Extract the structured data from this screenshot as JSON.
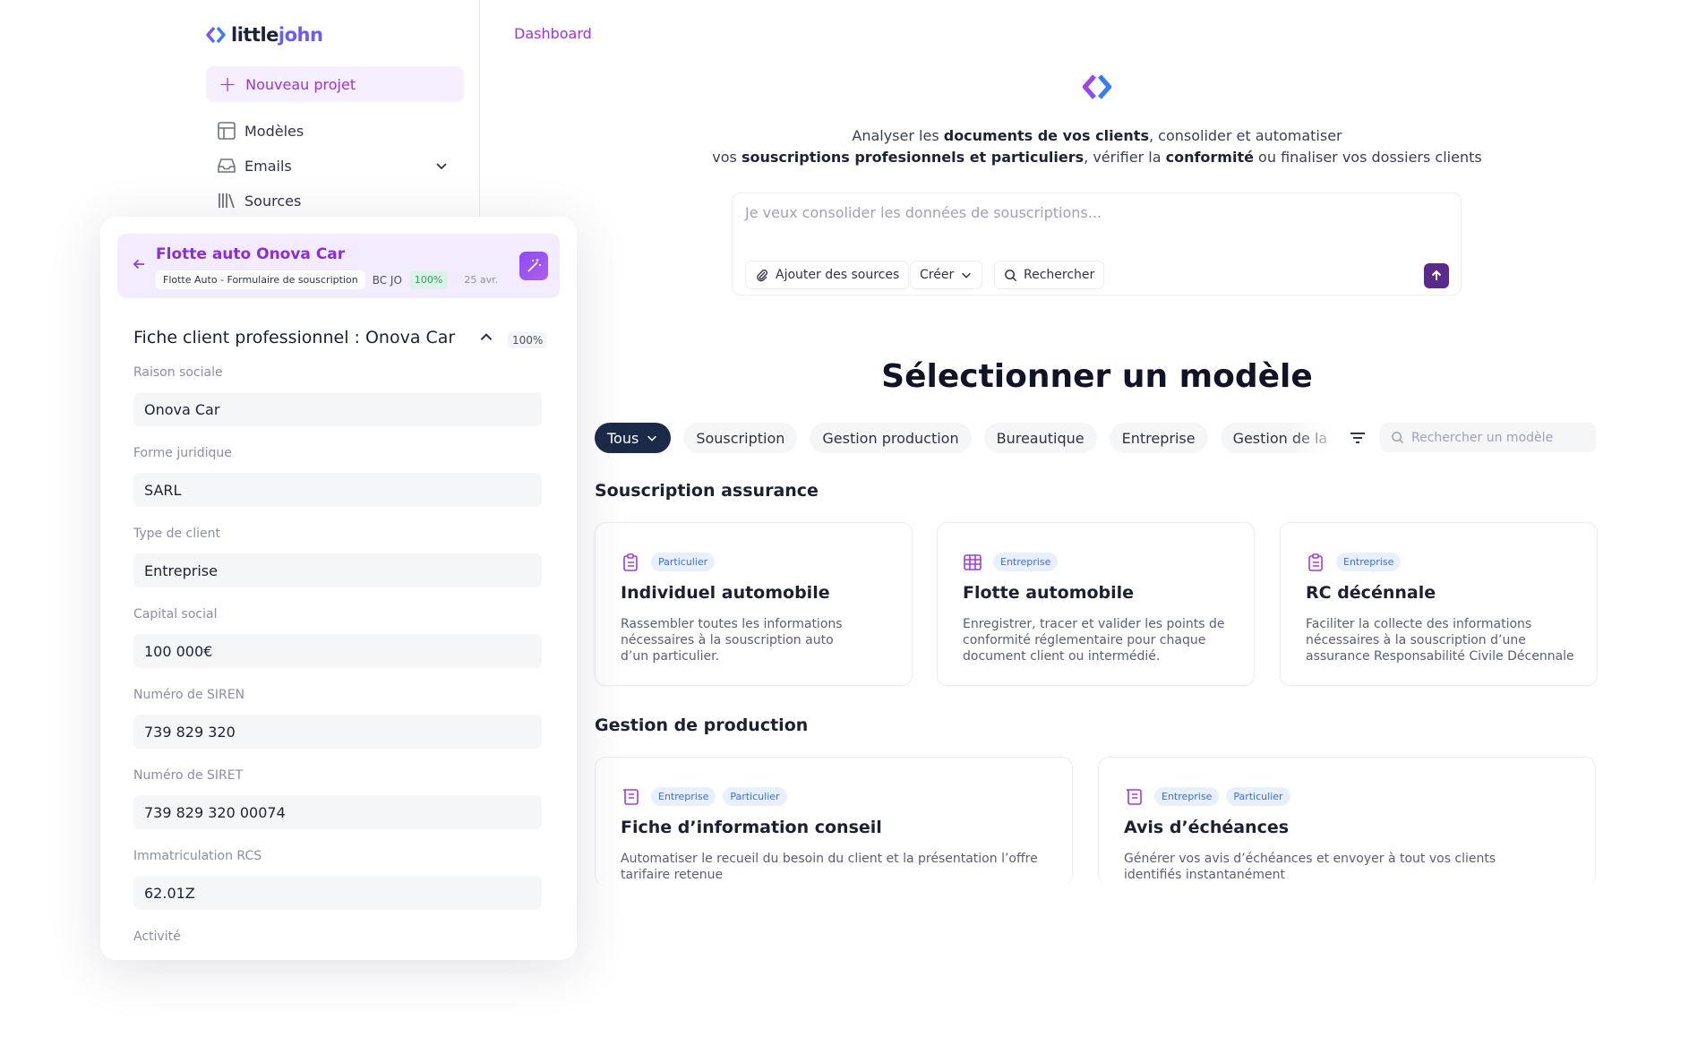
{
  "app": {
    "logo_prefix": "little",
    "logo_suffix": "john"
  },
  "sidebar": {
    "new_project": "Nouveau projet",
    "items": [
      {
        "label": "Modèles",
        "icon": "layout-icon"
      },
      {
        "label": "Emails",
        "icon": "inbox-icon"
      },
      {
        "label": "Sources",
        "icon": "library-icon"
      }
    ]
  },
  "record": {
    "title": "Flotte auto Onova Car",
    "form_chip": "Flotte Auto - Formulaire de souscription",
    "initials": "BC JO",
    "progress": "100%",
    "date": "25 avr."
  },
  "fiche": {
    "title": "Fiche client professionnel : Onova Car",
    "progress": "100%",
    "fields": [
      {
        "label": "Raison sociale",
        "value": "Onova Car"
      },
      {
        "label": "Forme juridique",
        "value": "SARL"
      },
      {
        "label": "Type de client",
        "value": "Entreprise"
      },
      {
        "label": "Capital social",
        "value": "100 000€"
      },
      {
        "label": "Numéro de SIREN",
        "value": "739 829 320"
      },
      {
        "label": "Numéro de SIRET",
        "value": "739 829 320 00074"
      },
      {
        "label": "Immatriculation RCS",
        "value": "62.01Z"
      },
      {
        "label": "Activité",
        "value": ""
      }
    ]
  },
  "main": {
    "breadcrumb": "Dashboard",
    "hero": {
      "l1_a": "Analyser les ",
      "l1_b": "documents de vos clients",
      "l1_c": ", consolider et automatiser",
      "l2_a": "vos ",
      "l2_b": "souscriptions profesionnels et particuliers",
      "l2_c": ", vérifier la ",
      "l2_d": "conformité",
      "l2_e": " ou finaliser vos dossiers clients"
    },
    "prompt": {
      "placeholder": "Je veux consolider les données de souscriptions...",
      "add_sources": "Ajouter des sources",
      "create": "Créer",
      "search": "Rechercher"
    },
    "section_title": "Sélectionner un modèle",
    "filters": [
      "Tous",
      "Souscription",
      "Gestion production",
      "Bureautique",
      "Entreprise",
      "Gestion de la"
    ],
    "search_placeholder": "Rechercher un modèle",
    "groups": [
      {
        "title": "Souscription assurance",
        "cards": [
          {
            "icon": "clipboard-icon",
            "badges": [
              "Particulier"
            ],
            "title": "Individuel automobile",
            "desc": "Rassembler toutes les informations nécessaires à la souscription auto d’un particulier."
          },
          {
            "icon": "table-icon",
            "badges": [
              "Entreprise"
            ],
            "title": "Flotte automobile",
            "desc": "Enregistrer, tracer et valider les points de conformité réglementaire pour chaque document client ou intermédié."
          },
          {
            "icon": "clipboard-icon",
            "badges": [
              "Entreprise"
            ],
            "title": "RC décénnale",
            "desc": "Faciliter la collecte des informations nécessaires à la souscription d’une assurance Responsabilité Civile Décennale"
          }
        ]
      },
      {
        "title": "Gestion de production",
        "cards": [
          {
            "icon": "scroll-icon",
            "badges": [
              "Entreprise",
              "Particulier"
            ],
            "title": "Fiche d’information conseil",
            "desc": "Automatiser le recueil du besoin du client et la présentation l’offre tarifaire retenue"
          },
          {
            "icon": "scroll-icon",
            "badges": [
              "Entreprise",
              "Particulier"
            ],
            "title": "Avis d’échéances",
            "desc": "Générer vos avis d’échéances et envoyer à tout vos clients identifiés instantanément"
          }
        ]
      }
    ]
  }
}
